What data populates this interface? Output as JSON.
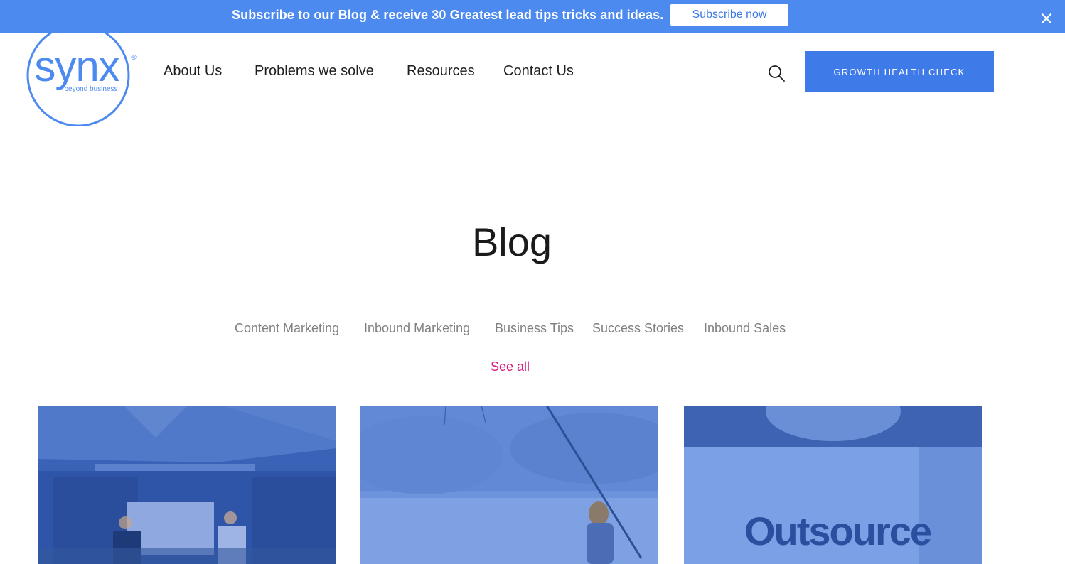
{
  "promo": {
    "text": "Subscribe to our Blog & receive 30 Greatest lead tips tricks and ideas.",
    "button_label": "Subscribe now"
  },
  "logo": {
    "name": "synx",
    "tagline": "beyond business",
    "mark": "®"
  },
  "nav": {
    "items": [
      {
        "label": "About Us"
      },
      {
        "label": "Problems we solve"
      },
      {
        "label": "Resources"
      },
      {
        "label": "Contact Us"
      }
    ],
    "cta_label": "GROWTH HEALTH CHECK"
  },
  "blog": {
    "title": "Blog",
    "categories": [
      {
        "label": "Content Marketing"
      },
      {
        "label": "Inbound Marketing"
      },
      {
        "label": "Business Tips"
      },
      {
        "label": "Success Stories"
      },
      {
        "label": "Inbound Sales"
      }
    ],
    "see_all_label": "See all"
  },
  "cards": [
    {
      "image": "presentation-stage-photo"
    },
    {
      "image": "child-fishing-photo"
    },
    {
      "image": "outsource-sign-photo",
      "image_text": "Outsource"
    }
  ],
  "colors": {
    "brand_blue": "#4d8af0",
    "cta_blue": "#3f7be8",
    "accent_pink": "#d61a7f",
    "category_gray": "#808080"
  }
}
